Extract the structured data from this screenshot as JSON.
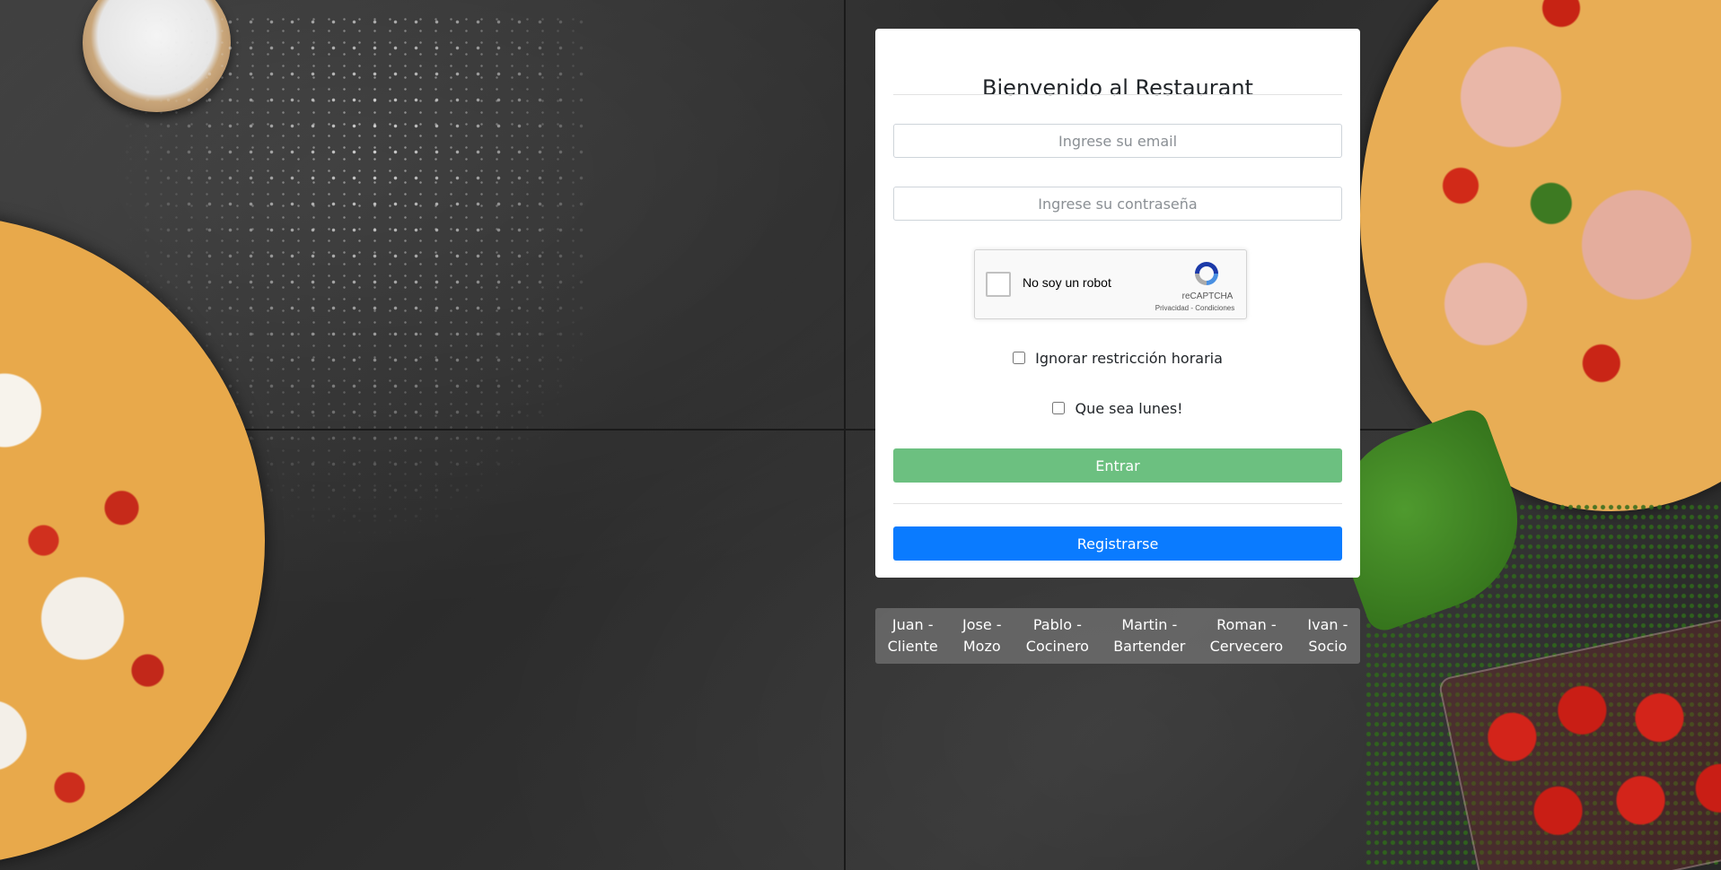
{
  "login": {
    "title": "Bienvenido al Restaurant",
    "email_placeholder": "Ingrese su email",
    "password_placeholder": "Ingrese su contraseña",
    "ignore_schedule_label": "Ignorar restricción horaria",
    "monday_label": "Que sea lunes!",
    "enter_label": "Entrar",
    "register_label": "Registrarse"
  },
  "recaptcha": {
    "label": "No soy un robot",
    "brand": "reCAPTCHA",
    "links": "Privacidad - Condiciones",
    "icon": "recaptcha-logo-icon"
  },
  "quick_users": [
    {
      "name": "Juan -",
      "role": "Cliente"
    },
    {
      "name": "Jose -",
      "role": "Mozo"
    },
    {
      "name": "Pablo -",
      "role": "Cocinero"
    },
    {
      "name": "Martin -",
      "role": "Bartender"
    },
    {
      "name": "Roman -",
      "role": "Cervecero"
    },
    {
      "name": "Ivan -",
      "role": "Socio"
    }
  ],
  "colors": {
    "enter_button": "#6cc080",
    "register_button": "#0a7bff",
    "card": "#ffffff",
    "quick_bar": "#6e6e6e"
  }
}
